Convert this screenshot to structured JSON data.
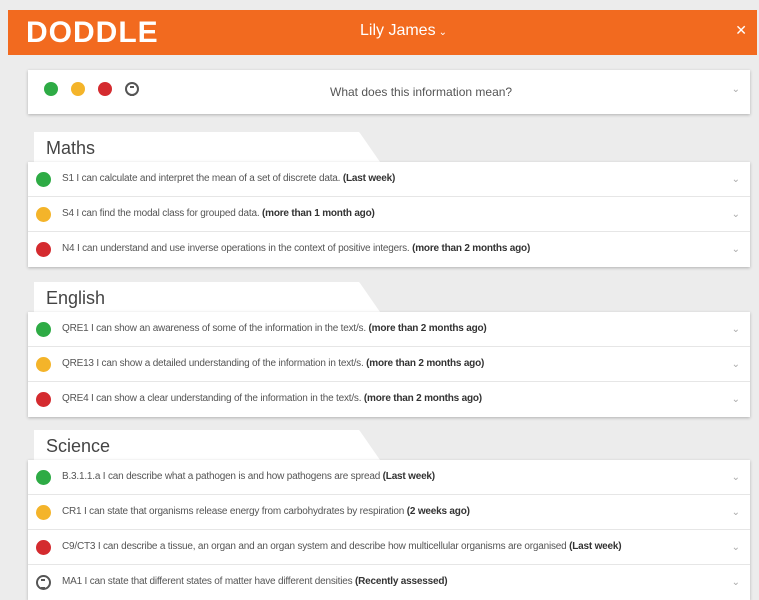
{
  "header": {
    "logo_text": "DODDLE",
    "user_name": "Lily James",
    "user_caret": "⌄",
    "close_glyph": "✕",
    "brand_color": "#f26a1f"
  },
  "key": {
    "question": "What does this information mean?",
    "dots": [
      "green",
      "amber",
      "red",
      "hourglass-icon"
    ]
  },
  "sections": [
    {
      "title": "Maths",
      "rows": [
        {
          "status": "green",
          "text": "S1 I can calculate and interpret the mean of a set of discrete data.",
          "when": "(Last week)"
        },
        {
          "status": "amber",
          "text": "S4 I can find the modal class for grouped data.",
          "when": "(more than 1 month ago)"
        },
        {
          "status": "red",
          "text": "N4 I can understand and use inverse operations in the context of positive integers.",
          "when": "(more than 2 months ago)"
        }
      ]
    },
    {
      "title": "English",
      "rows": [
        {
          "status": "green",
          "text": "QRE1 I can show an awareness of some of the information in the text/s.",
          "when": "(more than 2 months ago)"
        },
        {
          "status": "amber",
          "text": "QRE13 I can show a detailed understanding of the information in text/s.",
          "when": "(more than 2 months ago)"
        },
        {
          "status": "red",
          "text": "QRE4 I can show a clear understanding of the information in the text/s.",
          "when": "(more than 2 months ago)"
        }
      ]
    },
    {
      "title": "Science",
      "rows": [
        {
          "status": "green",
          "text": "B.3.1.1.a I can describe what a pathogen is and how pathogens are spread",
          "when": "(Last week)"
        },
        {
          "status": "amber",
          "text": "CR1 I can state that organisms release energy from carbohydrates by respiration",
          "when": "(2 weeks ago)"
        },
        {
          "status": "red",
          "text": "C9/CT3 I can describe a tissue, an organ and an organ system and describe how multicellular organisms are organised",
          "when": "(Last week)"
        },
        {
          "status": "hourglass",
          "text": "MA1 I can state that different states of matter have different densities",
          "when": "(Recently assessed)"
        }
      ]
    }
  ],
  "colors": {
    "green": "#2eab45",
    "amber": "#f4b42a",
    "red": "#d42b2f"
  }
}
